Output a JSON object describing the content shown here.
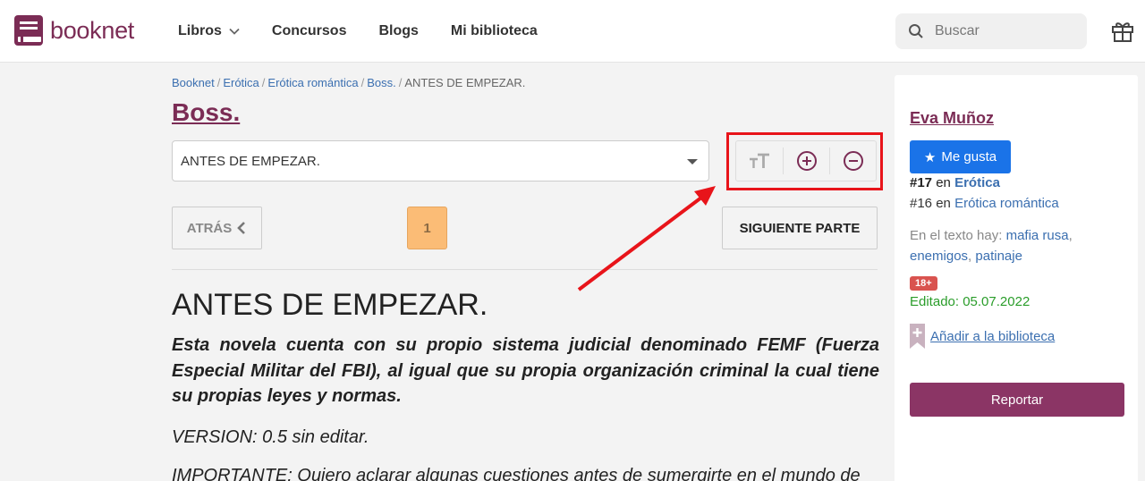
{
  "header": {
    "logo_text": "booknet",
    "nav": [
      {
        "label": "Libros"
      },
      {
        "label": "Concursos"
      },
      {
        "label": "Blogs"
      },
      {
        "label": "Mi biblioteca"
      }
    ],
    "search_placeholder": "Buscar"
  },
  "breadcrumb": [
    "Booknet",
    "Erótica",
    "Erótica romántica",
    "Boss.",
    "ANTES DE EMPEZAR."
  ],
  "book_title": "Boss.",
  "chapter_select_value": "ANTES DE EMPEZAR.",
  "nav_buttons": {
    "back_label": "ATRÁS",
    "page_number": "1",
    "next_label": "SIGUIENTE PARTE"
  },
  "content": {
    "heading": "ANTES DE EMPEZAR.",
    "paragraph1": "Esta novela cuenta con su propio sistema judicial denominado FEMF (Fuerza Especial Militar del FBI), al igual que su propia organización criminal la cual tiene su propias leyes y normas.",
    "paragraph2": "VERSION: 0.5 sin editar.",
    "paragraph3": "IMPORTANTE: Quiero aclarar algunas cuestiones antes de sumergirte en el mundo de"
  },
  "sidebar": {
    "author": "Eva Muñoz",
    "like_label": "Me gusta",
    "rank1_num": "#17",
    "rank1_en": "en",
    "rank1_cat": "Erótica",
    "rank2_num": "#16",
    "rank2_en": "en",
    "rank2_cat": "Erótica romántica",
    "tags_prefix": "En el texto hay:",
    "tags": [
      "mafia rusa",
      "enemigos",
      "patinaje"
    ],
    "age_badge": "18+",
    "edited": "Editado: 05.07.2022",
    "add_library": "Añadir a la biblioteca",
    "report_label": "Reportar"
  },
  "colors": {
    "brand": "#7b2c55",
    "link": "#3b6fb0",
    "like": "#1a73e8",
    "report": "#8b3565",
    "highlight": "#e8141a",
    "page_active": "#fbbc76"
  },
  "icons": [
    "book-logo-icon",
    "chevron-down-icon",
    "search-icon",
    "gift-icon",
    "font-size-icon",
    "zoom-in-icon",
    "zoom-out-icon",
    "chevron-left-icon",
    "star-icon",
    "bookmark-plus-icon"
  ]
}
